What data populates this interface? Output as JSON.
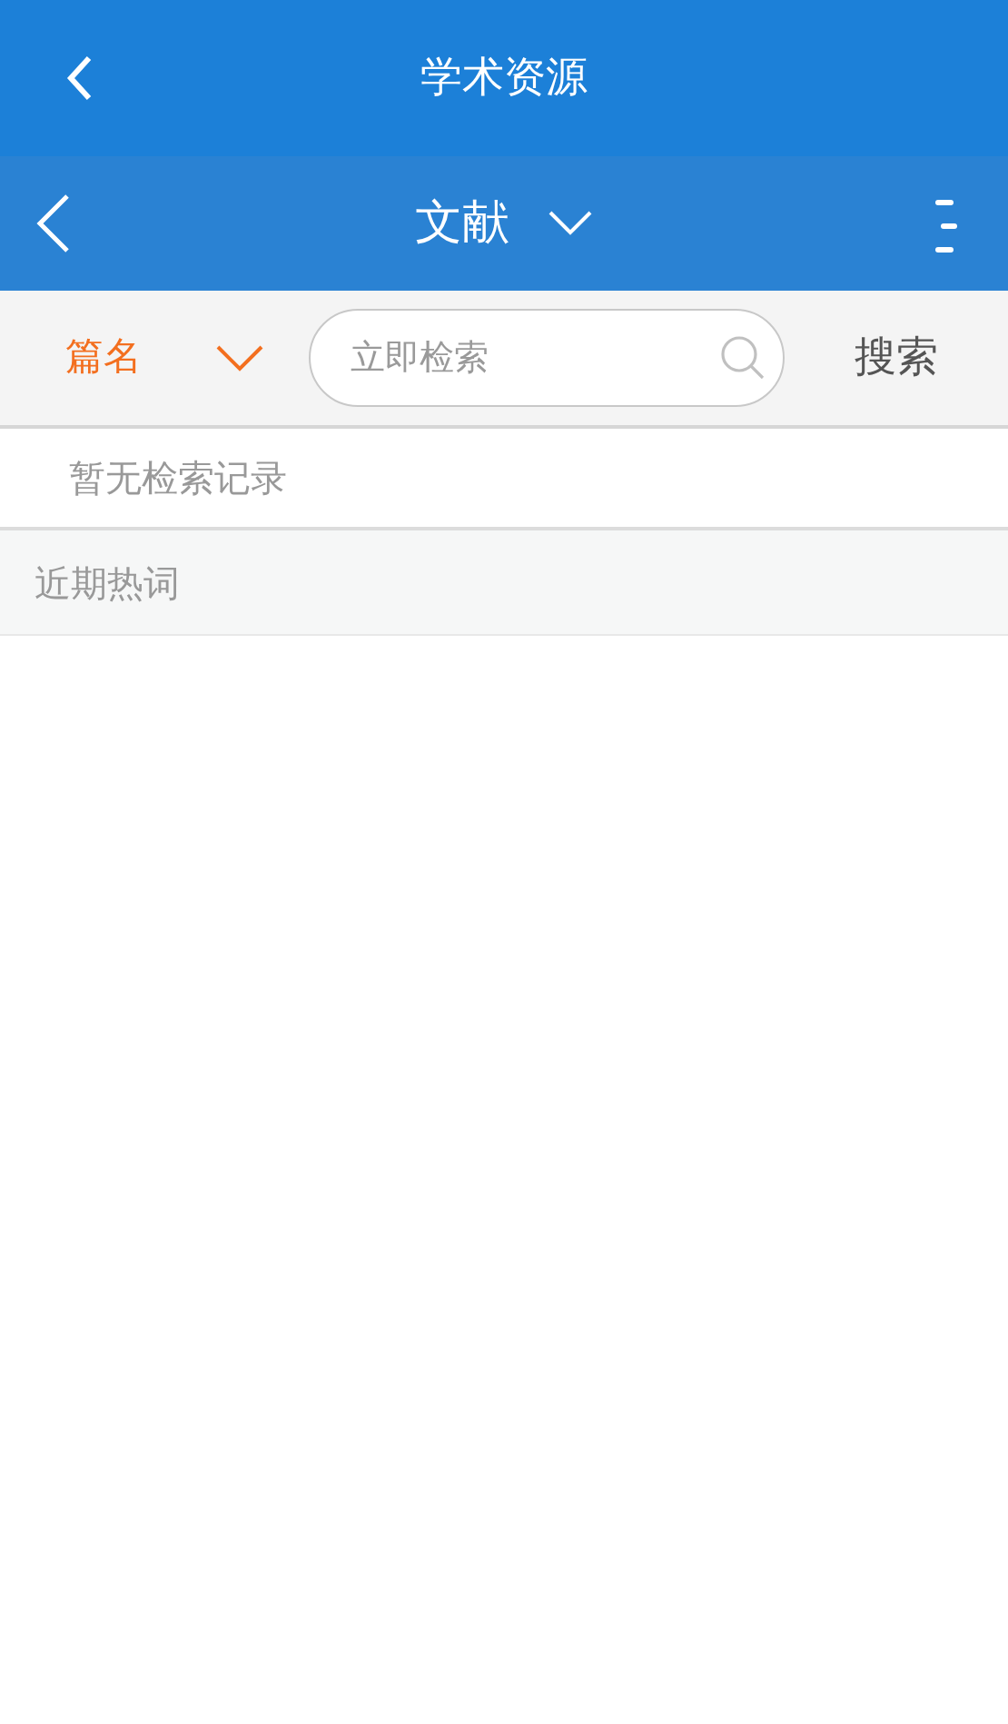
{
  "app_bar": {
    "title": "学术资源"
  },
  "toolbar": {
    "title": "文献"
  },
  "search_bar": {
    "field_type": "篇名",
    "placeholder": "立即检索",
    "button": "搜索"
  },
  "history": {
    "empty_text": "暂无检索记录"
  },
  "hot_words": {
    "heading": "近期热词"
  }
}
